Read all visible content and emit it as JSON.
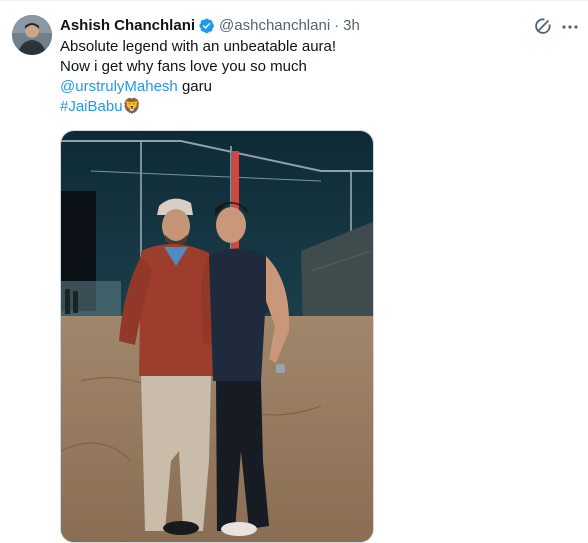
{
  "tweet": {
    "author_name": "Ashish Chanchlani",
    "handle": "@ashchanchlani",
    "separator": "·",
    "time": "3h",
    "text_line1": "Absolute legend with an unbeatable aura!",
    "text_line2": "Now i get why fans love you so much",
    "mention": "@urstrulyMahesh",
    "mention_suffix": " garu",
    "hashtag": "#JaiBabu",
    "emoji": "🦁"
  },
  "colors": {
    "link": "#1d9bf0",
    "verified": "#1d9bf0",
    "secondary_text": "#536471"
  },
  "icons": [
    "verified-badge-icon",
    "grok-icon",
    "more-options-icon",
    "lion-emoji-icon"
  ]
}
